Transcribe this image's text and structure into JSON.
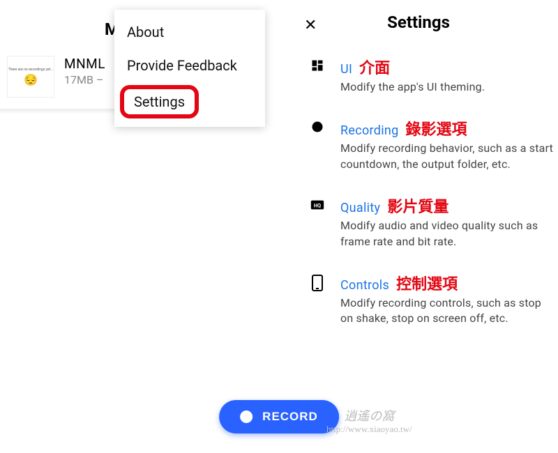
{
  "left": {
    "header_letter": "M",
    "item_name": "MNML",
    "item_size": "17MB –",
    "thumb_text": "There are no recordings yet..."
  },
  "menu": {
    "about": "About",
    "feedback": "Provide Feedback",
    "settings": "Settings"
  },
  "right": {
    "title": "Settings",
    "sections": [
      {
        "title": "UI",
        "hanzi": "介面",
        "desc": "Modify the app's UI theming."
      },
      {
        "title": "Recording",
        "hanzi": "錄影選項",
        "desc": "Modify recording behavior, such as a start countdown, the output folder, etc."
      },
      {
        "title": "Quality",
        "hanzi": "影片質量",
        "desc": "Modify audio and video quality such as frame rate and bit rate."
      },
      {
        "title": "Controls",
        "hanzi": "控制選項",
        "desc": "Modify recording controls, such as stop on shake, stop on screen off, etc."
      }
    ]
  },
  "record_label": "RECORD",
  "watermark": {
    "top": "逍遙の窩",
    "url": "http://www.xiaoyao.tw/"
  }
}
